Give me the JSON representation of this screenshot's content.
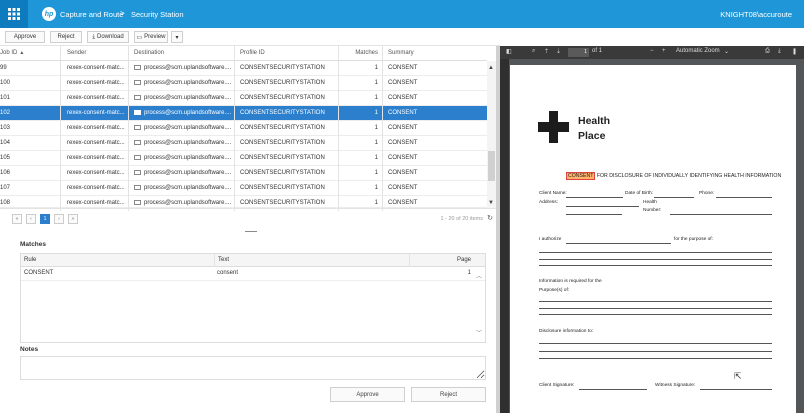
{
  "header": {
    "app_title": "Capture and Route",
    "separator": ">",
    "station_title": "Security Station",
    "user": "KNIGHT08\\accuroute",
    "bg_color": "#1e96d8"
  },
  "toolbar": {
    "approve_label": "Approve",
    "reject_label": "Reject",
    "download_label": "Download",
    "preview_label": "Preview"
  },
  "jobs_table": {
    "columns": [
      "Job ID",
      "Sender",
      "Destination",
      "Profile ID",
      "Matches",
      "Summary"
    ],
    "rows": [
      {
        "job_id": "99",
        "sender": "rexex-consent-matc...",
        "destination": "process@scm.uplandsoftware....",
        "profile": "CONSENTSECURITYSTATION",
        "matches": "1",
        "summary": "CONSENT"
      },
      {
        "job_id": "100",
        "sender": "rexex-consent-matc...",
        "destination": "process@scm.uplandsoftware....",
        "profile": "CONSENTSECURITYSTATION",
        "matches": "1",
        "summary": "CONSENT"
      },
      {
        "job_id": "101",
        "sender": "rexex-consent-matc...",
        "destination": "process@scm.uplandsoftware....",
        "profile": "CONSENTSECURITYSTATION",
        "matches": "1",
        "summary": "CONSENT"
      },
      {
        "job_id": "102",
        "sender": "rexex-consent-matc...",
        "destination": "process@scm.uplandsoftware....",
        "profile": "CONSENTSECURITYSTATION",
        "matches": "1",
        "summary": "CONSENT"
      },
      {
        "job_id": "103",
        "sender": "rexex-consent-matc...",
        "destination": "process@scm.uplandsoftware....",
        "profile": "CONSENTSECURITYSTATION",
        "matches": "1",
        "summary": "CONSENT"
      },
      {
        "job_id": "104",
        "sender": "rexex-consent-matc...",
        "destination": "process@scm.uplandsoftware....",
        "profile": "CONSENTSECURITYSTATION",
        "matches": "1",
        "summary": "CONSENT"
      },
      {
        "job_id": "105",
        "sender": "rexex-consent-matc...",
        "destination": "process@scm.uplandsoftware....",
        "profile": "CONSENTSECURITYSTATION",
        "matches": "1",
        "summary": "CONSENT"
      },
      {
        "job_id": "106",
        "sender": "rexex-consent-matc...",
        "destination": "process@scm.uplandsoftware....",
        "profile": "CONSENTSECURITYSTATION",
        "matches": "1",
        "summary": "CONSENT"
      },
      {
        "job_id": "107",
        "sender": "rexex-consent-matc...",
        "destination": "process@scm.uplandsoftware....",
        "profile": "CONSENTSECURITYSTATION",
        "matches": "1",
        "summary": "CONSENT"
      },
      {
        "job_id": "108",
        "sender": "rexex-consent-matc...",
        "destination": "process@scm.uplandsoftware....",
        "profile": "CONSENTSECURITYSTATION",
        "matches": "1",
        "summary": "CONSENT"
      }
    ],
    "selected_job_id": "102",
    "selected_color": "#2b7fcd"
  },
  "pager": {
    "current_page": "1",
    "info": "1 - 20 of 20 items"
  },
  "matches": {
    "title": "Matches",
    "columns": [
      "Rule",
      "Text",
      "Page"
    ],
    "rows": [
      {
        "rule": "CONSENT",
        "text": "consent",
        "page": "1"
      }
    ]
  },
  "notes": {
    "title": "Notes",
    "value": ""
  },
  "footer": {
    "approve_label": "Approve",
    "reject_label": "Reject"
  },
  "pdf_viewer": {
    "page_number": "1",
    "page_count": "of 1",
    "zoom": "Automatic Zoom"
  },
  "document": {
    "org_name_line1": "Health",
    "org_name_line2": "Place",
    "title_highlight": "CONSENT",
    "title_rest": "FOR DISCLOSURE OF INDIVIDUALLY IDENTIFYING HEALTH INFORMATION",
    "client_name_label": "Client Name:",
    "dob_label": "Date of Birth:",
    "phone_label": "Phone:",
    "address_label": "Address:",
    "health_label": "Health",
    "number_label": "Number:",
    "authorize_label": "I authorize",
    "purpose_label": "for the purpose of:",
    "info_required_label": "Information is required for the",
    "purposes_label": "Purpose(s) of:",
    "disclosure_label": "Disclosure information to:",
    "client_sig_label": "Client Signature:",
    "witness_sig_label": "Witness Signature:"
  }
}
